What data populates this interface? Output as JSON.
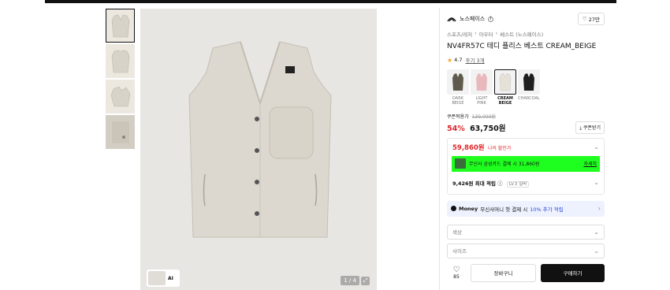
{
  "thumbnails": [
    "front",
    "back",
    "side",
    "detail"
  ],
  "image": {
    "ai_label": "AI",
    "counter": "1 / 4"
  },
  "brand": {
    "name": "노스페이스",
    "info": "i",
    "like_count": "27만"
  },
  "breadcrumb": [
    "스포츠/레저",
    "아우터",
    "베스트 (노스페이스)"
  ],
  "breadcrumb_sep": "›",
  "title": "NV4FR57C 테디 플리스 베스트 CREAM_BEIGE",
  "rating": {
    "score": "4.7",
    "reviews": "후기 3개"
  },
  "colors": [
    {
      "label": "DARK BEIGE",
      "hex": "#5f5a4c"
    },
    {
      "label": "LIGHT PINK",
      "hex": "#e9b8bc"
    },
    {
      "label": "CREAM BEIGE",
      "hex": "#e5e1d6",
      "selected": true
    },
    {
      "label": "CHARCOAL",
      "hex": "#1e1e1e"
    }
  ],
  "price": {
    "coupon_label": "쿠폰적용가",
    "original": "139,000원",
    "discount": "54%",
    "final": "63,750원",
    "coupon_button": "쿠폰받기"
  },
  "benefit": {
    "my_price": "59,860원",
    "my_price_label": "나의 할인가",
    "card_text": "무신사 삼성카드 결제 시 31,860원",
    "card_detail": "자세히",
    "points": "9,426원 최대 적립",
    "points_tag": "LV.3 실버"
  },
  "pay_banner": {
    "brand": "Money",
    "text": "무신사머니 첫 결제 시",
    "highlight": "10% 추가 적립"
  },
  "selects": {
    "color_placeholder": "색상",
    "size_placeholder": "사이즈"
  },
  "actions": {
    "wish_count": "85",
    "cart": "장바구니",
    "buy": "구매하기"
  },
  "accent": {
    "red": "#e0262b",
    "green": "#1fff1f",
    "blue": "#2a4bd7"
  }
}
